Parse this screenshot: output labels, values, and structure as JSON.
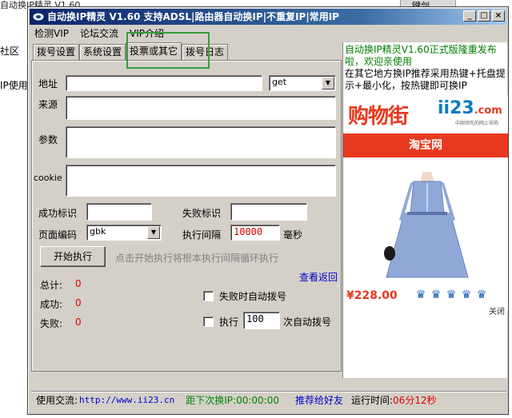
{
  "background": {
    "top_left_text": "自动换IP精灵 V1.60",
    "top_right_text": "键剑",
    "left_text_1": "社区",
    "left_text_2": "IP使用"
  },
  "window": {
    "title": "自动换IP精灵 V1.60 支持ADSL|路由器自动换IP|不重复IP|常用IP",
    "minimize": "_",
    "maximize": "□",
    "close": "×"
  },
  "menu": {
    "items": [
      "检测VIP",
      "论坛交流",
      "VIP介绍"
    ]
  },
  "tabs": [
    "拨号设置",
    "系统设置",
    "投票或其它",
    "拨号日志"
  ],
  "form": {
    "address_label": "地址",
    "address_value": "",
    "method_value": "get",
    "source_label": "来源",
    "params_label": "参数",
    "cookie_label": "cookie",
    "success_label": "成功标识",
    "success_value": "",
    "fail_label": "失败标识",
    "fail_value": "",
    "encoding_label": "页面编码",
    "encoding_value": "gbk",
    "interval_label": "执行间隔",
    "interval_value": "10000",
    "interval_unit": "毫秒",
    "start_button": "开始执行",
    "start_hint": "点击开始执行将根本执行间隔循环执行",
    "view_back": "查看返回",
    "total_label": "总计:",
    "total_value": "0",
    "success_count_label": "成功:",
    "success_count_value": "0",
    "fail_count_label": "失败:",
    "fail_count_value": "0",
    "auto_dial_on_fail": "失败时自动拨号",
    "exec_label": "执行",
    "exec_value": "100",
    "exec_suffix": "次自动拨号"
  },
  "ad": {
    "text_green": "自动换IP精灵V1.60正式版隆重发布啦，欢迎亲使用",
    "text_black": "在其它地方换IP推荐采用热键+托盘提示+最小化，按热键即可换IP",
    "logo_main": "购物街",
    "logo_site": "ii23",
    "logo_com": ".com",
    "logo_sub": "中国领先的网上导购",
    "banner": "淘宝网",
    "price": "¥228.00",
    "close": "关闭"
  },
  "status": {
    "exchange_label": "使用交流:",
    "url": "http://www.ii23.cn",
    "next_dial": "距下次换IP:00:00:00",
    "recommend": "推荐给好友",
    "runtime_label": "运行时间:",
    "runtime_value": "06分12秒"
  }
}
